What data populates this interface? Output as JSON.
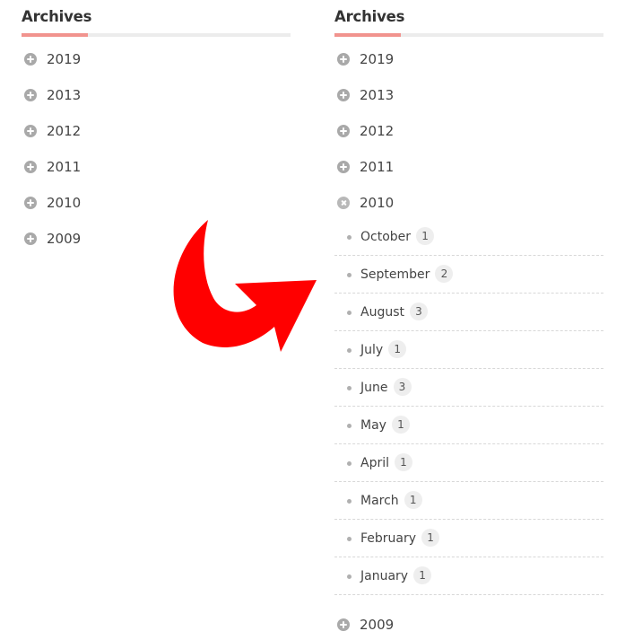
{
  "left_widget": {
    "title": "Archives",
    "years": [
      {
        "label": "2019",
        "icon": "plus-circle-icon"
      },
      {
        "label": "2013",
        "icon": "plus-circle-icon"
      },
      {
        "label": "2012",
        "icon": "plus-circle-icon"
      },
      {
        "label": "2011",
        "icon": "plus-circle-icon"
      },
      {
        "label": "2010",
        "icon": "plus-circle-icon"
      },
      {
        "label": "2009",
        "icon": "plus-circle-icon"
      }
    ]
  },
  "right_widget": {
    "title": "Archives",
    "years_before": [
      {
        "label": "2019",
        "icon": "plus-circle-icon"
      },
      {
        "label": "2013",
        "icon": "plus-circle-icon"
      },
      {
        "label": "2012",
        "icon": "plus-circle-icon"
      },
      {
        "label": "2011",
        "icon": "plus-circle-icon"
      }
    ],
    "expanded_year": {
      "label": "2010",
      "icon": "close-circle-icon"
    },
    "months": [
      {
        "label": "October",
        "count": "1"
      },
      {
        "label": "September",
        "count": "2"
      },
      {
        "label": "August",
        "count": "3"
      },
      {
        "label": "July",
        "count": "1"
      },
      {
        "label": "June",
        "count": "3"
      },
      {
        "label": "May",
        "count": "1"
      },
      {
        "label": "April",
        "count": "1"
      },
      {
        "label": "March",
        "count": "1"
      },
      {
        "label": "February",
        "count": "1"
      },
      {
        "label": "January",
        "count": "1"
      }
    ],
    "years_after": [
      {
        "label": "2009",
        "icon": "plus-circle-icon"
      }
    ]
  },
  "colors": {
    "title_accent": "#f1938e",
    "title_rule": "#ececec",
    "icon_gray": "#a9a9a9",
    "arrow_red": "#ff0000",
    "count_badge_bg": "#eeeeee"
  },
  "decoration": {
    "arrow_icon": "curved-arrow-icon"
  }
}
